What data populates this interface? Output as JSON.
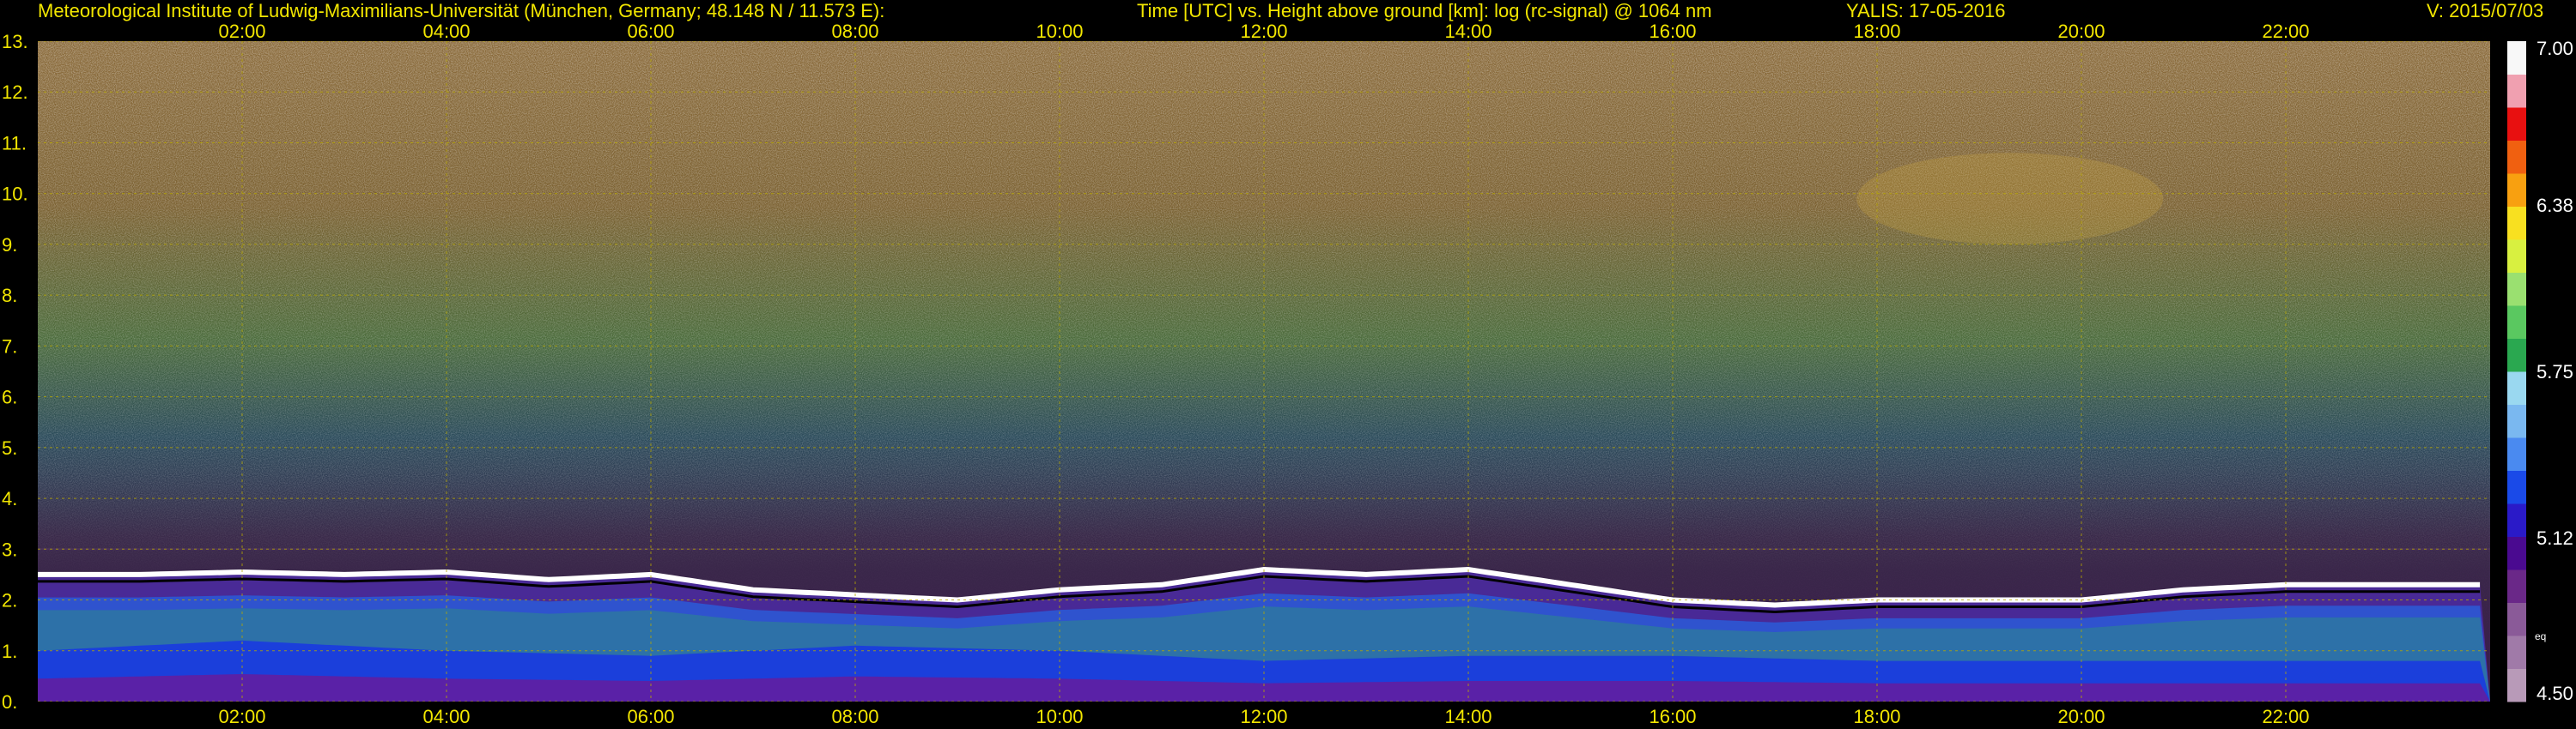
{
  "header": {
    "institute": "Meteorological Institute of Ludwig-Maximilians-Universität (München, Germany; 48.148 N / 11.573 E):",
    "description": "Time [UTC] vs. Height above ground [km]: log (rc-signal) @ 1064 nm",
    "instrument_date": "YALIS: 17-05-2016",
    "version": "V: 2015/07/03"
  },
  "colors": {
    "text": "#f2e600",
    "grid": "#b8a800",
    "background": "#000000"
  },
  "chart_data": {
    "type": "heatmap",
    "x_tick_labels": [
      "02:00",
      "04:00",
      "06:00",
      "08:00",
      "10:00",
      "12:00",
      "14:00",
      "16:00",
      "18:00",
      "20:00",
      "22:00"
    ],
    "x_tick_hours": [
      2,
      4,
      6,
      8,
      10,
      12,
      14,
      16,
      18,
      20,
      22
    ],
    "xlim_hours": [
      0,
      24
    ],
    "y_tick_labels": [
      "0.",
      "1.",
      "2.",
      "3.",
      "4.",
      "5.",
      "6.",
      "7.",
      "8.",
      "9.",
      "10.",
      "11.",
      "12.",
      "13."
    ],
    "ylim_km": [
      0,
      13
    ],
    "grid": true,
    "colorbar": {
      "min": 4.5,
      "max": 7.0,
      "tick_labels": [
        "7.00",
        "6.38",
        "5.75",
        "5.12",
        "4.50"
      ],
      "tick_values": [
        7.0,
        6.38,
        5.75,
        5.12,
        4.5
      ],
      "small_label": "eq",
      "colors": [
        "#b89ab8",
        "#a07aa8",
        "#8a5a98",
        "#6a2888",
        "#4a0a90",
        "#2a1ac8",
        "#1a4ae8",
        "#4a8af0",
        "#7ab8f0",
        "#9ad8f0",
        "#2aa850",
        "#5ac860",
        "#9ae070",
        "#d8f040",
        "#f8e020",
        "#f8a010",
        "#f06010",
        "#e81010",
        "#f0a0b0",
        "#f8f8f8"
      ]
    },
    "features": {
      "boundary_layer_top_km": [
        [
          0.0,
          2.5
        ],
        [
          1.0,
          2.5
        ],
        [
          2.0,
          2.55
        ],
        [
          3.0,
          2.5
        ],
        [
          4.0,
          2.55
        ],
        [
          5.0,
          2.4
        ],
        [
          6.0,
          2.5
        ],
        [
          7.0,
          2.2
        ],
        [
          8.0,
          2.1
        ],
        [
          9.0,
          2.0
        ],
        [
          10.0,
          2.2
        ],
        [
          11.0,
          2.3
        ],
        [
          12.0,
          2.6
        ],
        [
          13.0,
          2.5
        ],
        [
          14.0,
          2.6
        ],
        [
          15.0,
          2.3
        ],
        [
          16.0,
          2.0
        ],
        [
          17.0,
          1.9
        ],
        [
          18.0,
          2.0
        ],
        [
          19.0,
          2.0
        ],
        [
          20.0,
          2.0
        ],
        [
          21.0,
          2.2
        ],
        [
          22.0,
          2.3
        ],
        [
          23.0,
          2.3
        ],
        [
          24.0,
          2.3
        ]
      ],
      "surface_layer_top_km": [
        [
          0.0,
          1.0
        ],
        [
          2.0,
          1.2
        ],
        [
          4.0,
          1.0
        ],
        [
          6.0,
          0.9
        ],
        [
          8.0,
          1.1
        ],
        [
          10.0,
          1.0
        ],
        [
          12.0,
          0.8
        ],
        [
          14.0,
          0.9
        ],
        [
          16.0,
          0.9
        ],
        [
          18.0,
          0.8
        ],
        [
          20.0,
          0.8
        ],
        [
          22.0,
          0.8
        ],
        [
          24.0,
          0.8
        ]
      ],
      "noise_onset_km": 3.0,
      "cirrus_hours": [
        17.8,
        20.8
      ],
      "cirrus_km": [
        9.0,
        10.8
      ]
    }
  }
}
